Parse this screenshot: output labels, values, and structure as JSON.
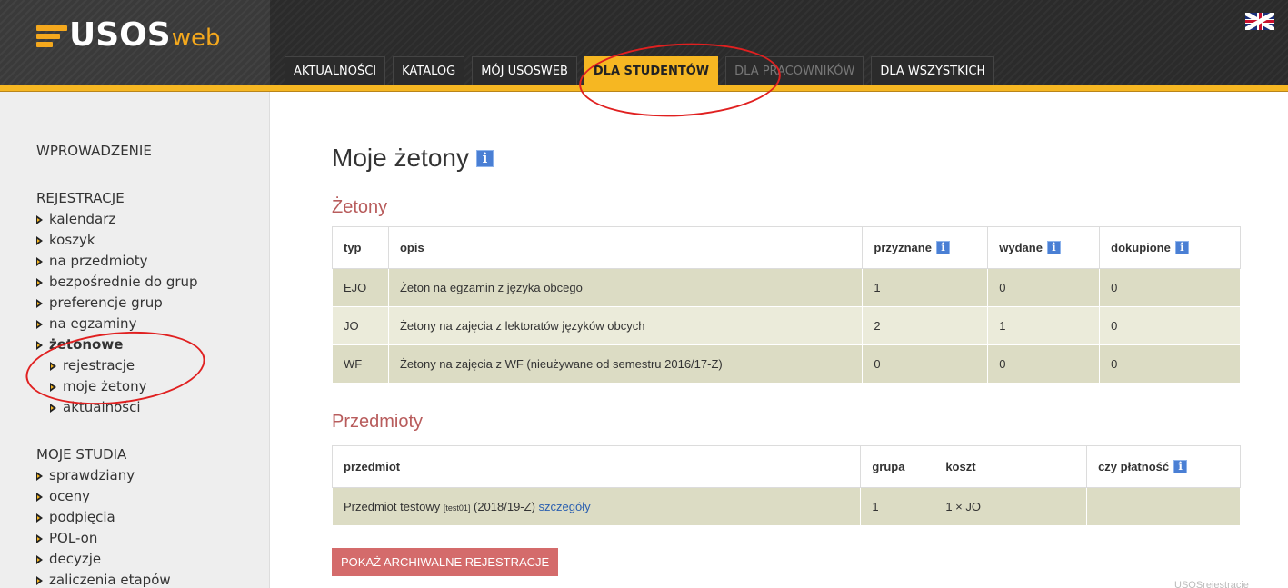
{
  "logo": {
    "main": "USOS",
    "sub": "web"
  },
  "nav": {
    "tabs": [
      {
        "label": "AKTUALNOŚCI",
        "state": "normal"
      },
      {
        "label": "KATALOG",
        "state": "normal"
      },
      {
        "label": "MÓJ USOSWEB",
        "state": "normal"
      },
      {
        "label": "DLA STUDENTÓW",
        "state": "active"
      },
      {
        "label": "DLA PRACOWNIKÓW",
        "state": "dim"
      },
      {
        "label": "DLA WSZYSTKICH",
        "state": "normal"
      }
    ]
  },
  "sidebar": {
    "intro": "WPROWADZENIE",
    "rejestracje": {
      "heading": "REJESTRACJE",
      "items": [
        "kalendarz",
        "koszyk",
        "na przedmioty",
        "bezpośrednie do grup",
        "preferencje grup",
        "na egzaminy"
      ],
      "zetonowe": "żetonowe",
      "zetonowe_items": [
        "rejestracje",
        "moje żetony",
        "aktualności"
      ]
    },
    "moje_studia": {
      "heading": "MOJE STUDIA",
      "items": [
        "sprawdziany",
        "oceny",
        "podpięcia",
        "POL-on",
        "decyzje",
        "zaliczenia etapów"
      ]
    }
  },
  "main": {
    "title": "Moje żetony",
    "info_glyph": "i",
    "zetony": {
      "title": "Żetony",
      "headers": {
        "typ": "typ",
        "opis": "opis",
        "przyznane": "przyznane",
        "wydane": "wydane",
        "dokupione": "dokupione"
      },
      "rows": [
        {
          "typ": "EJO",
          "opis": "Żeton na egzamin z języka obcego",
          "przyznane": "1",
          "wydane": "0",
          "dokupione": "0"
        },
        {
          "typ": "JO",
          "opis": "Żetony na zajęcia z lektoratów języków obcych",
          "przyznane": "2",
          "wydane": "1",
          "dokupione": "0"
        },
        {
          "typ": "WF",
          "opis": "Żetony na zajęcia z WF (nieużywane od semestru 2016/17-Z)",
          "przyznane": "0",
          "wydane": "0",
          "dokupione": "0"
        }
      ]
    },
    "przedmioty": {
      "title": "Przedmioty",
      "headers": {
        "przedmiot": "przedmiot",
        "grupa": "grupa",
        "koszt": "koszt",
        "platnosc": "czy płatność"
      },
      "rows": [
        {
          "name": "Przedmiot testowy",
          "code": "[test01]",
          "term": "(2018/19-Z)",
          "link": "szczegóły",
          "grupa": "1",
          "koszt": "1 × JO",
          "platnosc": ""
        }
      ]
    },
    "archive_button": "POKAŻ ARCHIWALNE REJESTRACJE",
    "footer": "USOSrejestracje"
  },
  "colors": {
    "accent": "#f6b722",
    "section_title": "#b85c5c",
    "button": "#d46b6b",
    "annotation": "#e02020"
  }
}
